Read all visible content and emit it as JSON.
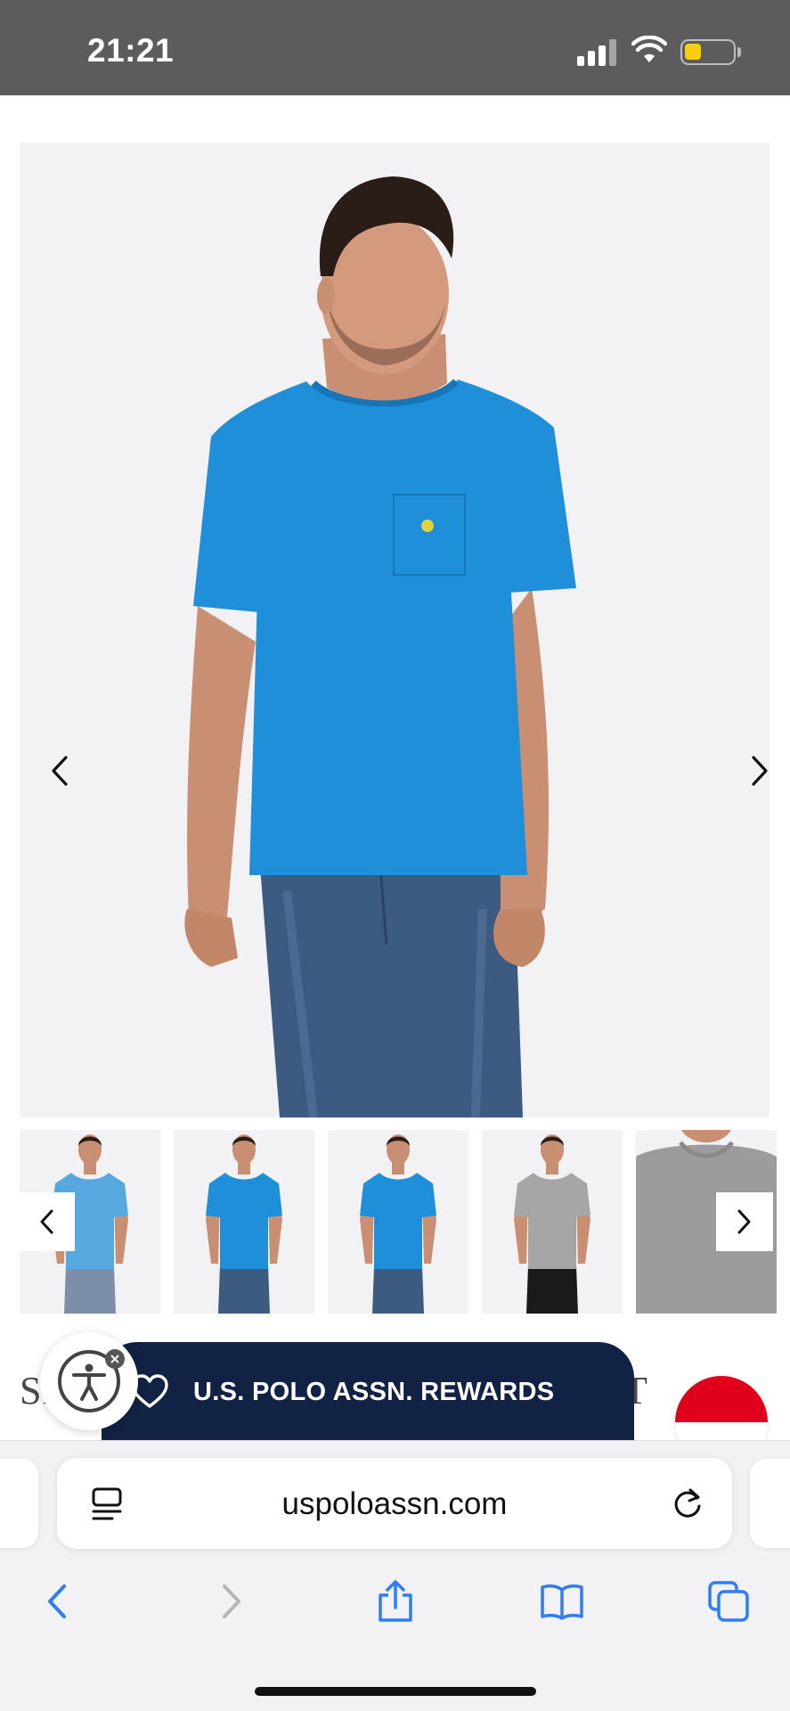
{
  "status_bar": {
    "time": "21:21",
    "battery_level": 0.35,
    "battery_color": "#f5cf0b"
  },
  "hero": {
    "prev_icon": "chevron-left-icon",
    "next_icon": "chevron-right-icon",
    "expand_icon": "expand-arrows-icon",
    "expand_button_color": "#b11f3a",
    "shirt_color": "#1e8fd8"
  },
  "thumbnails": [
    {
      "shirt_color": "#58a8e0",
      "pants_color": "#7d8fa8",
      "view": "front"
    },
    {
      "shirt_color": "#1e8fd8",
      "pants_color": "#3d5a80",
      "view": "three-quarter"
    },
    {
      "shirt_color": "#1e8fd8",
      "pants_color": "#3d5a80",
      "view": "back"
    },
    {
      "shirt_color": "#a6a6a6",
      "pants_color": "#1a1a1a",
      "view": "front"
    },
    {
      "shirt_color": "#9c9c9c",
      "pants_color": "#9c9c9c",
      "view": "detail"
    }
  ],
  "product": {
    "title_peek": "SM",
    "title_peek_right": "T"
  },
  "accessibility": {
    "icon": "accessibility-icon",
    "close_icon": "close-icon"
  },
  "rewards": {
    "label": "U.S. POLO ASSN. REWARDS",
    "icon": "heart-icon",
    "bg_color": "#112244"
  },
  "browser": {
    "url": "uspoloassn.com",
    "reader_icon": "reader-mode-icon",
    "reload_icon": "reload-icon",
    "toolbar": [
      "back-icon",
      "forward-icon",
      "share-icon",
      "bookmarks-icon",
      "tabs-icon"
    ],
    "accent_color": "#2f7cf6"
  }
}
